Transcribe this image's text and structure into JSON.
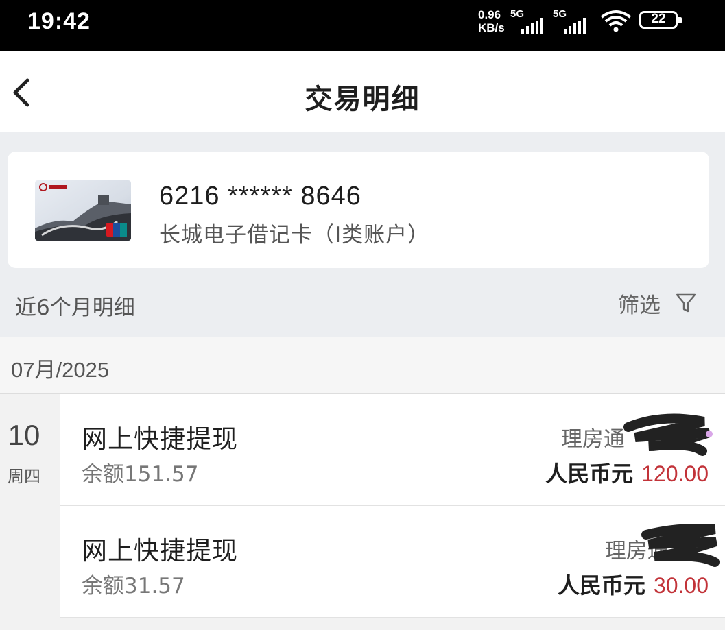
{
  "status_bar": {
    "time": "19:42",
    "net_speed_value": "0.96",
    "net_speed_unit": "KB/s",
    "signal_1": "5G",
    "signal_2": "5G",
    "battery": "22",
    "icons": [
      "signal-icon",
      "wifi-icon",
      "battery-icon"
    ],
    "background": "#000000"
  },
  "nav": {
    "title": "交易明细",
    "back_icon": "chevron-left-icon"
  },
  "card": {
    "number": "6216 ****** 8646",
    "type": "长城电子借记卡（Ⅰ类账户）",
    "image_icon": "bank-card-image"
  },
  "filter_bar": {
    "period_label": "近6个月明细",
    "filter_label": "筛选",
    "filter_icon": "funnel-icon"
  },
  "month_header": "07月/2025",
  "date_group": {
    "day": "10",
    "weekday": "周四"
  },
  "transactions": [
    {
      "title": "网上快捷提现",
      "balance": "余额151.57",
      "counterparty": "理房通",
      "currency": "人民币元",
      "amount": "120.00"
    },
    {
      "title": "网上快捷提现",
      "balance": "余额31.57",
      "counterparty": "理房通-阿",
      "currency": "人民币元",
      "amount": "30.00"
    }
  ],
  "colors": {
    "amount": "#c23339",
    "page_background": "#eceef1",
    "panel": "#ffffff"
  }
}
